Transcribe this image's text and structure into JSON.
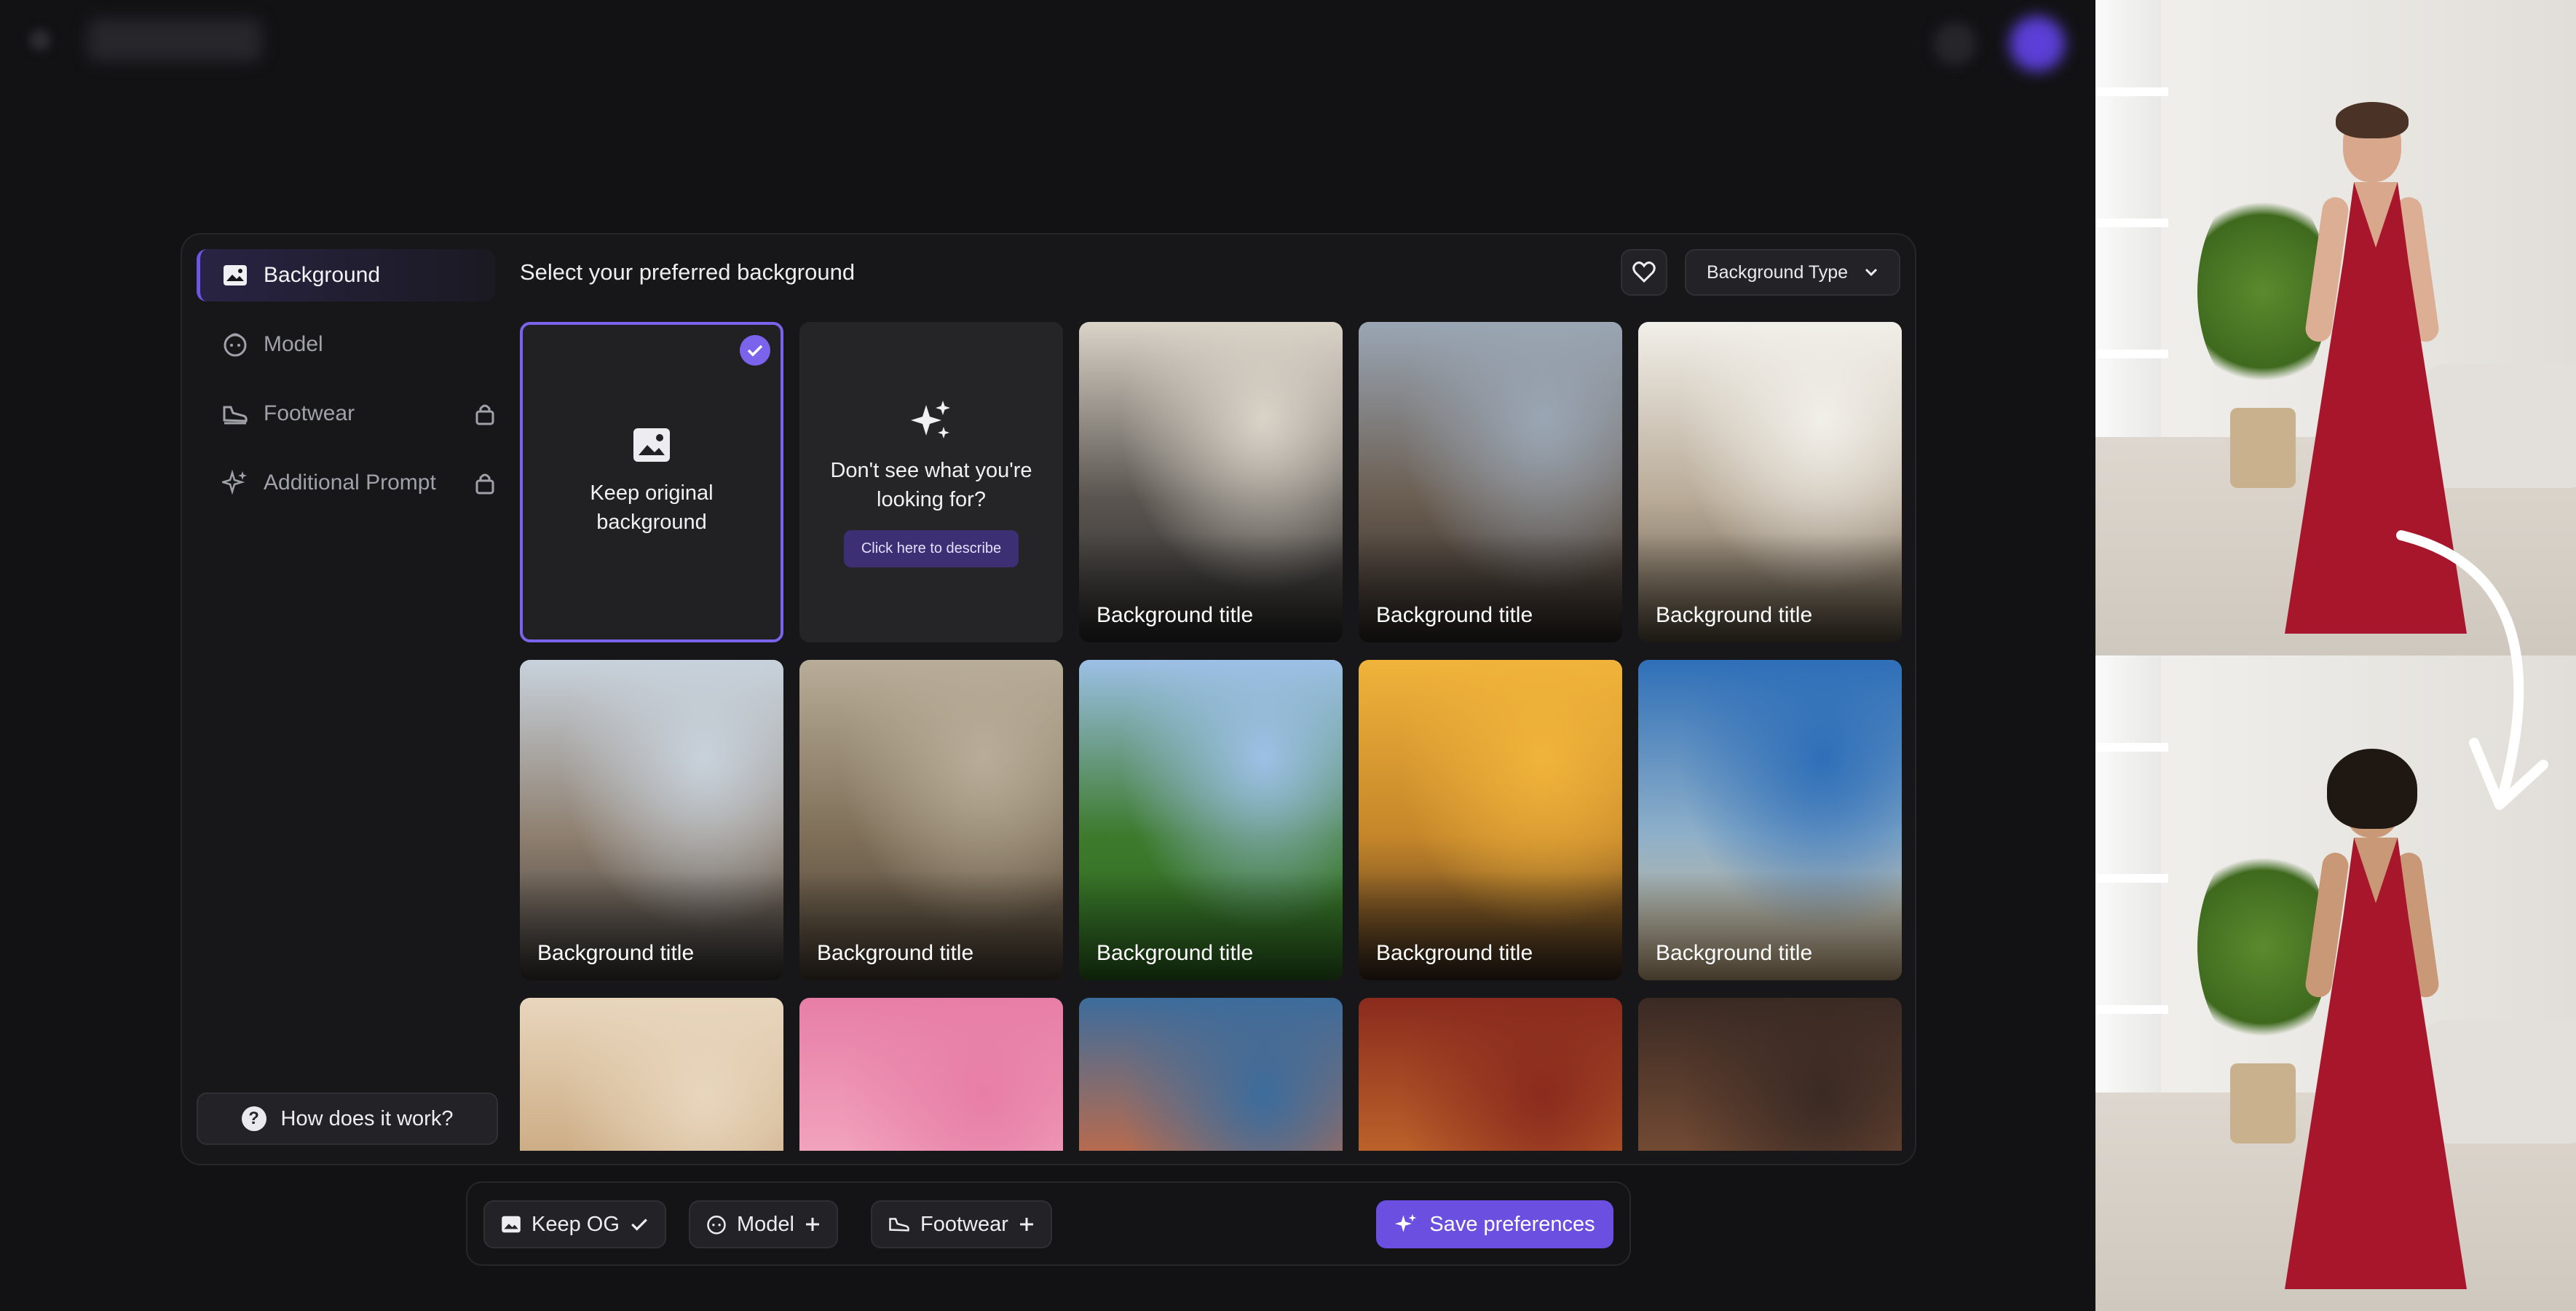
{
  "sidebar": {
    "items": [
      {
        "label": "Background",
        "icon": "image-frame-icon",
        "active": true,
        "locked": false
      },
      {
        "label": "Model",
        "icon": "face-icon",
        "active": false,
        "locked": false
      },
      {
        "label": "Footwear",
        "icon": "shoe-icon",
        "active": false,
        "locked": true
      },
      {
        "label": "Additional Prompt",
        "icon": "sparkles-icon",
        "active": false,
        "locked": true
      }
    ],
    "help_label": "How does it work?"
  },
  "content": {
    "heading": "Select your preferred background",
    "type_dropdown_label": "Background Type",
    "keep_card": {
      "label": "Keep original background"
    },
    "describe_card": {
      "label": "Don't see what you're looking for?",
      "button": "Click here to describe"
    },
    "cards": [
      {
        "label": "Background title",
        "scene": "office",
        "colors": [
          "#d9d3c8",
          "#5a5550",
          "#2b2a2a"
        ]
      },
      {
        "label": "Background title",
        "scene": "lounge",
        "colors": [
          "#9aa6b4",
          "#6b5e52",
          "#2d2723"
        ]
      },
      {
        "label": "Background title",
        "scene": "cafe",
        "colors": [
          "#f1efe9",
          "#b9ab98",
          "#5c5142"
        ]
      },
      {
        "label": "Background title",
        "scene": "street",
        "colors": [
          "#c8d2dc",
          "#8e7f6f",
          "#3a3836"
        ]
      },
      {
        "label": "Background title",
        "scene": "fireplace",
        "colors": [
          "#b8ad98",
          "#7f6f59",
          "#4a3f33"
        ]
      },
      {
        "label": "Background title",
        "scene": "garden",
        "colors": [
          "#9cc0e6",
          "#3d7a2c",
          "#2e6a22"
        ]
      },
      {
        "label": "Background title",
        "scene": "gym",
        "colors": [
          "#f0b33a",
          "#c5862a",
          "#3a2a1f"
        ]
      },
      {
        "label": "Background title",
        "scene": "beach",
        "colors": [
          "#2f6fb8",
          "#8fb0c9",
          "#d6b98c"
        ]
      },
      {
        "label": "",
        "scene": "arch",
        "colors": [
          "#e8d6bd",
          "#c9a77d",
          "#a07a52"
        ]
      },
      {
        "label": "",
        "scene": "pink-door",
        "colors": [
          "#e77ea6",
          "#f3a8c0",
          "#d36a93"
        ]
      },
      {
        "label": "",
        "scene": "alley",
        "colors": [
          "#3c6c9c",
          "#c96b43",
          "#4c8c6c"
        ]
      },
      {
        "label": "",
        "scene": "palace",
        "colors": [
          "#8a2b1e",
          "#c26a2c",
          "#5a1a12"
        ]
      },
      {
        "label": "",
        "scene": "dining",
        "colors": [
          "#3a2a24",
          "#7a4f36",
          "#1a1412"
        ]
      }
    ]
  },
  "bottom_bar": {
    "chips": [
      {
        "label": "Keep OG",
        "icon": "image-frame-icon",
        "action_icon": "check-icon"
      },
      {
        "label": "Model",
        "icon": "face-icon",
        "action_icon": "plus-icon"
      },
      {
        "label": "Footwear",
        "icon": "shoe-icon",
        "action_icon": "plus-icon"
      }
    ],
    "save_label": "Save preferences"
  },
  "colors": {
    "accent": "#6f55e6",
    "dress": "#a8162c"
  }
}
